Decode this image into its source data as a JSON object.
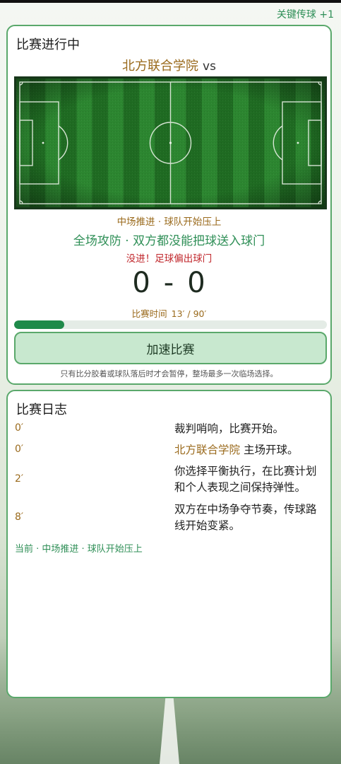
{
  "header": {
    "link": "关键传球 +1"
  },
  "match": {
    "title": "比赛进行中",
    "home_team": "北方联合学院",
    "vs": "vs",
    "phase": "中场推进 · 球队开始压上",
    "event": "全场攻防 · 双方都没能把球送入球门",
    "result": "没进！足球偏出球门",
    "score_home": "0",
    "score_sep": "-",
    "score_away": "0",
    "time_label": "比赛时间",
    "time_value": "13′ / 90′",
    "progress": 0.16,
    "speed_button": "加速比赛",
    "note": "只有比分胶着或球队落后时才会暂停，整场最多一次临场选择。",
    "colors": {
      "accent": "#2f8f57",
      "team": "#9a6a1c",
      "alert": "#c0262b",
      "pitch_dark": "#1f6b22",
      "pitch_light": "#2f8a33"
    }
  },
  "log": {
    "title": "比赛日志",
    "entries": [
      {
        "minute": "0′",
        "text": "裁判哨响，比赛开始。"
      },
      {
        "minute": "0′",
        "team": "北方联合学院",
        "text": " 主场开球。"
      },
      {
        "minute": "2′",
        "text": "你选择平衡执行，在比赛计划和个人表现之间保持弹性。"
      },
      {
        "minute": "8′",
        "text": "双方在中场争夺节奏，传球路线开始变紧。"
      }
    ],
    "current": "当前 · 中场推进 · 球队开始压上"
  }
}
